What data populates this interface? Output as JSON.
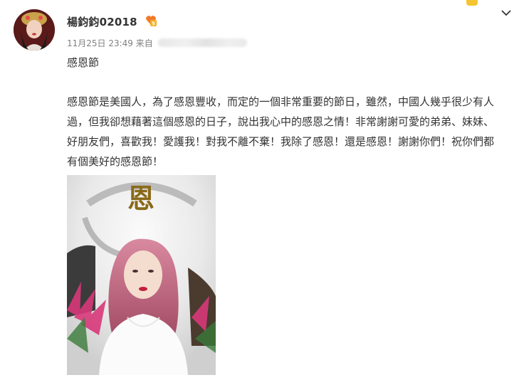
{
  "post": {
    "username": "楊鈞鈞02018",
    "timestamp": "11月25日 23:49",
    "source_prefix": "来自",
    "title": "感恩節",
    "body": "感恩節是美國人，為了感恩豐收，而定的一個非常重要的節日，雖然，中國人幾乎很少有人過，但我卻想藉著這個感恩的日子，說出我心中的感恩之情！非常謝謝可愛的弟弟、妹妹、好朋友們，喜歡我！愛護我！對我不離不棄！我除了感恩！還是感恩！謝謝你們！祝你們都有個美好的感恩節！",
    "image_calligraphy": "恩"
  },
  "icons": {
    "vip": "vip-badge-icon",
    "menu": "chevron-down-icon"
  },
  "colors": {
    "username": "#333333",
    "meta": "#808080",
    "vip_badge": "#f07a2a",
    "corner_badge": "#f5c531"
  }
}
